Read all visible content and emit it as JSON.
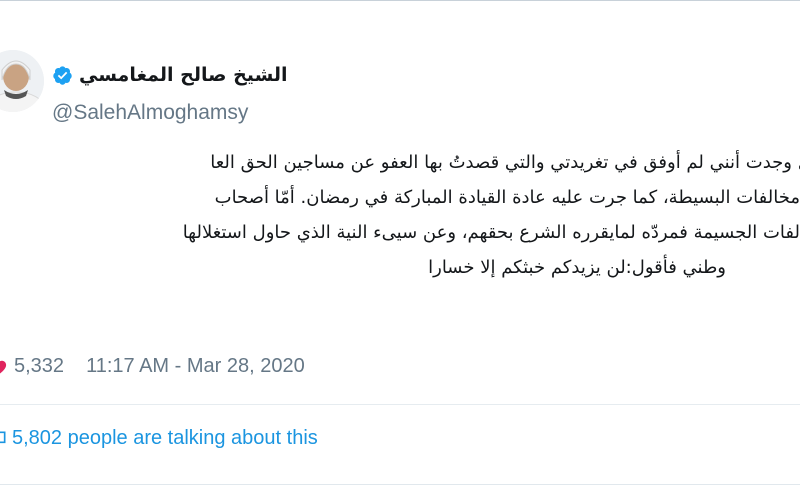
{
  "author": {
    "display_name": "الشيخ صالح المغامسي",
    "handle": "@SalehAlmoghamsy",
    "verified": true
  },
  "tweet": {
    "lines": [
      "أمل وجدت أنني لم أوفق في تغريدتي والتي قصدتُ بها العفو عن مساجين الحق العا",
      "مخالفات البسيطة، كما جرت عليه عادة القيادة المباركة في رمضان. أمّا أصحاب",
      "الفات الجسيمة فمردّه لمايقرره الشرع بحقهم، وعن سيىء النية الذي حاول استغلالها",
      "وطني فأقول:لن يزيدكم خبثكم إلا خسارا"
    ]
  },
  "meta": {
    "like_count": "5,332",
    "time": "11:17 AM",
    "separator": " - ",
    "date": "Mar 28, 2020"
  },
  "engagement": {
    "talking_text": "5,802 people are talking about this"
  },
  "colors": {
    "verified": "#1da1f2",
    "secondary_text": "#657786",
    "link": "#1b95e0",
    "heart": "#e0245e"
  },
  "icons": {
    "verified": "verified-badge-icon",
    "like": "heart-icon",
    "talk": "speech-bubble-icon"
  }
}
